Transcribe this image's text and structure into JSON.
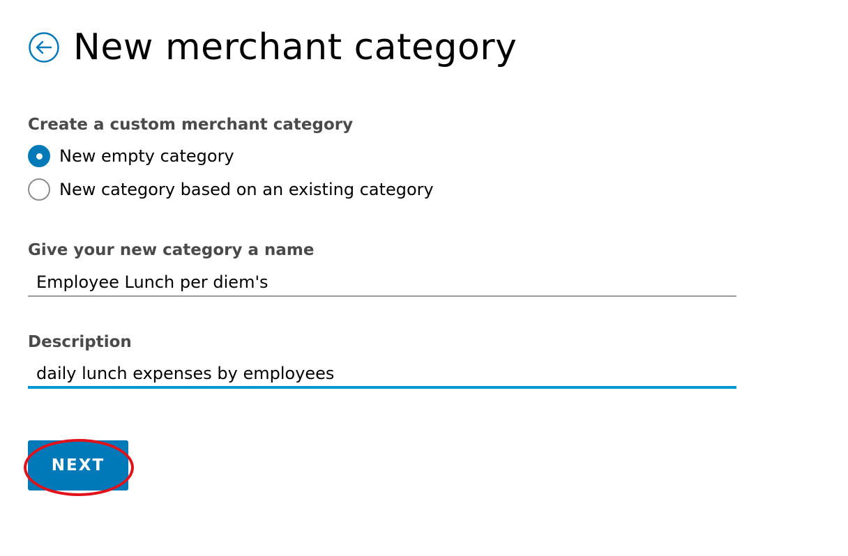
{
  "header": {
    "back_icon": "arrow-left-circle-icon",
    "title": "New merchant category"
  },
  "category_type": {
    "label": "Create a custom merchant category",
    "options": [
      {
        "label": "New empty category",
        "selected": true
      },
      {
        "label": "New category based on an existing category",
        "selected": false
      }
    ]
  },
  "name_field": {
    "label": "Give your new category a name",
    "value": "Employee Lunch per diem's"
  },
  "description_field": {
    "label": "Description",
    "value": "daily lunch expenses by employees"
  },
  "actions": {
    "next_label": "NEXT"
  },
  "colors": {
    "primary": "#0079b8",
    "focus_underline": "#0095d3",
    "annotation": "#e0131c"
  }
}
